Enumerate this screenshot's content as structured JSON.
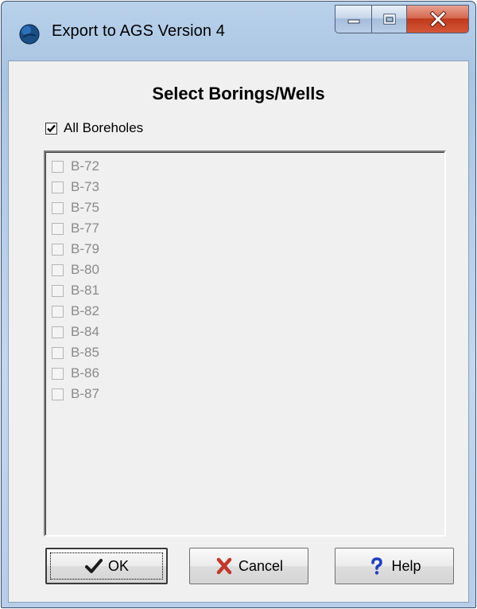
{
  "window": {
    "title": "Export to AGS Version 4",
    "caption_buttons": {
      "minimize": "minimize-icon",
      "maximize": "maximize-icon",
      "close": "close-icon"
    }
  },
  "dialog": {
    "heading": "Select Borings/Wells",
    "all_boreholes": {
      "label": "All Boreholes",
      "checked": true
    },
    "boreholes": [
      {
        "label": "B-72",
        "checked": false,
        "enabled": false
      },
      {
        "label": "B-73",
        "checked": false,
        "enabled": false
      },
      {
        "label": "B-75",
        "checked": false,
        "enabled": false
      },
      {
        "label": "B-77",
        "checked": false,
        "enabled": false
      },
      {
        "label": "B-79",
        "checked": false,
        "enabled": false
      },
      {
        "label": "B-80",
        "checked": false,
        "enabled": false
      },
      {
        "label": "B-81",
        "checked": false,
        "enabled": false
      },
      {
        "label": "B-82",
        "checked": false,
        "enabled": false
      },
      {
        "label": "B-84",
        "checked": false,
        "enabled": false
      },
      {
        "label": "B-85",
        "checked": false,
        "enabled": false
      },
      {
        "label": "B-86",
        "checked": false,
        "enabled": false
      },
      {
        "label": "B-87",
        "checked": false,
        "enabled": false
      }
    ]
  },
  "buttons": {
    "ok": {
      "label": "OK",
      "icon": "checkmark-icon"
    },
    "cancel": {
      "label": "Cancel",
      "icon": "x-mark-icon"
    },
    "help": {
      "label": "Help",
      "icon": "question-mark-icon"
    }
  },
  "colors": {
    "ok_check": "#1a1a1a",
    "cancel_x": "#c0392b",
    "help_q": "#1f3fbf",
    "close_button": "#c9452b"
  }
}
